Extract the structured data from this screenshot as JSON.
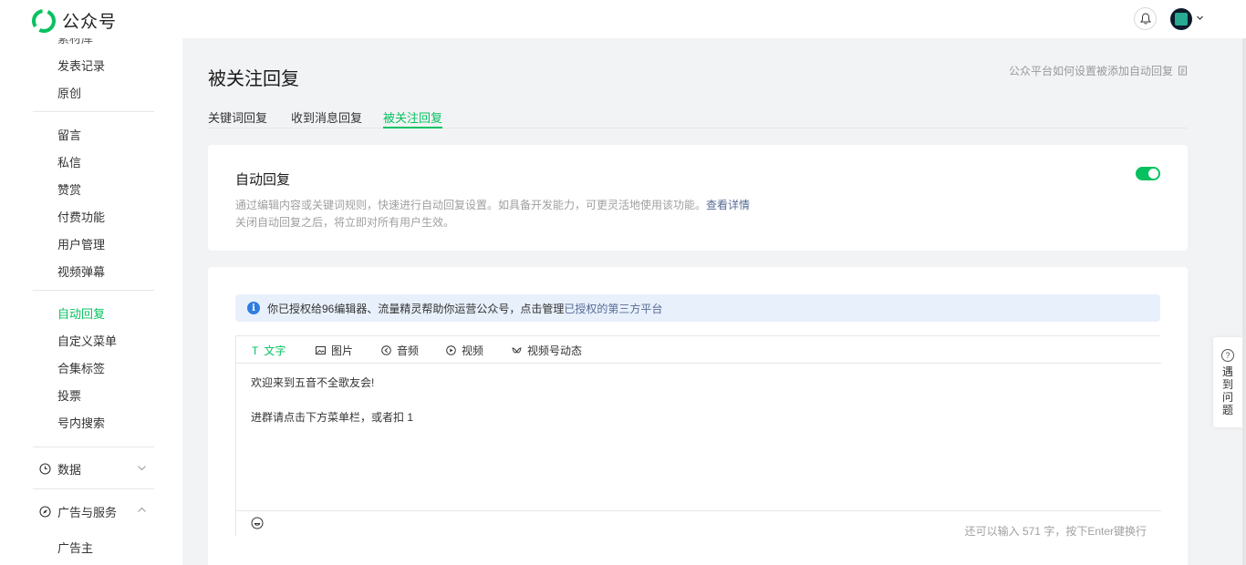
{
  "app": {
    "title": "公众号"
  },
  "sidebar": {
    "cut_top": "素材库",
    "items": [
      {
        "label": "发表记录"
      },
      {
        "label": "原创"
      },
      {
        "label": "留言"
      },
      {
        "label": "私信"
      },
      {
        "label": "赞赏"
      },
      {
        "label": "付费功能"
      },
      {
        "label": "用户管理"
      },
      {
        "label": "视频弹幕"
      },
      {
        "label": "自动回复",
        "active": true
      },
      {
        "label": "自定义菜单"
      },
      {
        "label": "合集标签"
      },
      {
        "label": "投票"
      },
      {
        "label": "号内搜索"
      }
    ],
    "groups": [
      {
        "label": "数据",
        "icon": "clock-icon",
        "expanded": false
      },
      {
        "label": "广告与服务",
        "icon": "compass-icon",
        "expanded": true
      }
    ],
    "sub_items": [
      {
        "label": "广告主"
      }
    ]
  },
  "page": {
    "title": "被关注回复",
    "help_link": "公众平台如何设置被添加自动回复",
    "tabs": [
      {
        "label": "关键词回复"
      },
      {
        "label": "收到消息回复"
      },
      {
        "label": "被关注回复",
        "active": true
      }
    ]
  },
  "auto_reply": {
    "title": "自动回复",
    "desc_line1": "通过编辑内容或关键词规则，快速进行自动回复设置。如具备开发能力，可更灵活地使用该功能。",
    "desc_link": "查看详情",
    "desc_line2": "关闭自动回复之后，将立即对所有用户生效。",
    "enabled": true
  },
  "notice": {
    "text": "你已授权给96编辑器、流量精灵帮助你运营公众号，点击管理",
    "link": "已授权的第三方平台"
  },
  "editor": {
    "tabs": [
      {
        "label": "文字",
        "icon": "text-icon",
        "active": true
      },
      {
        "label": "图片",
        "icon": "image-icon"
      },
      {
        "label": "音频",
        "icon": "audio-icon"
      },
      {
        "label": "视频",
        "icon": "video-icon"
      },
      {
        "label": "视频号动态",
        "icon": "channels-icon"
      }
    ],
    "content_line1": "欢迎来到五音不全歌友会!",
    "content_line2": "进群请点击下方菜单栏，或者扣 1",
    "counter": "还可以输入 571 字，按下Enter键换行"
  },
  "float_help": {
    "label": "遇到问题"
  },
  "colors": {
    "accent": "#07c160",
    "link": "#576b95",
    "info": "#2f7de1"
  }
}
